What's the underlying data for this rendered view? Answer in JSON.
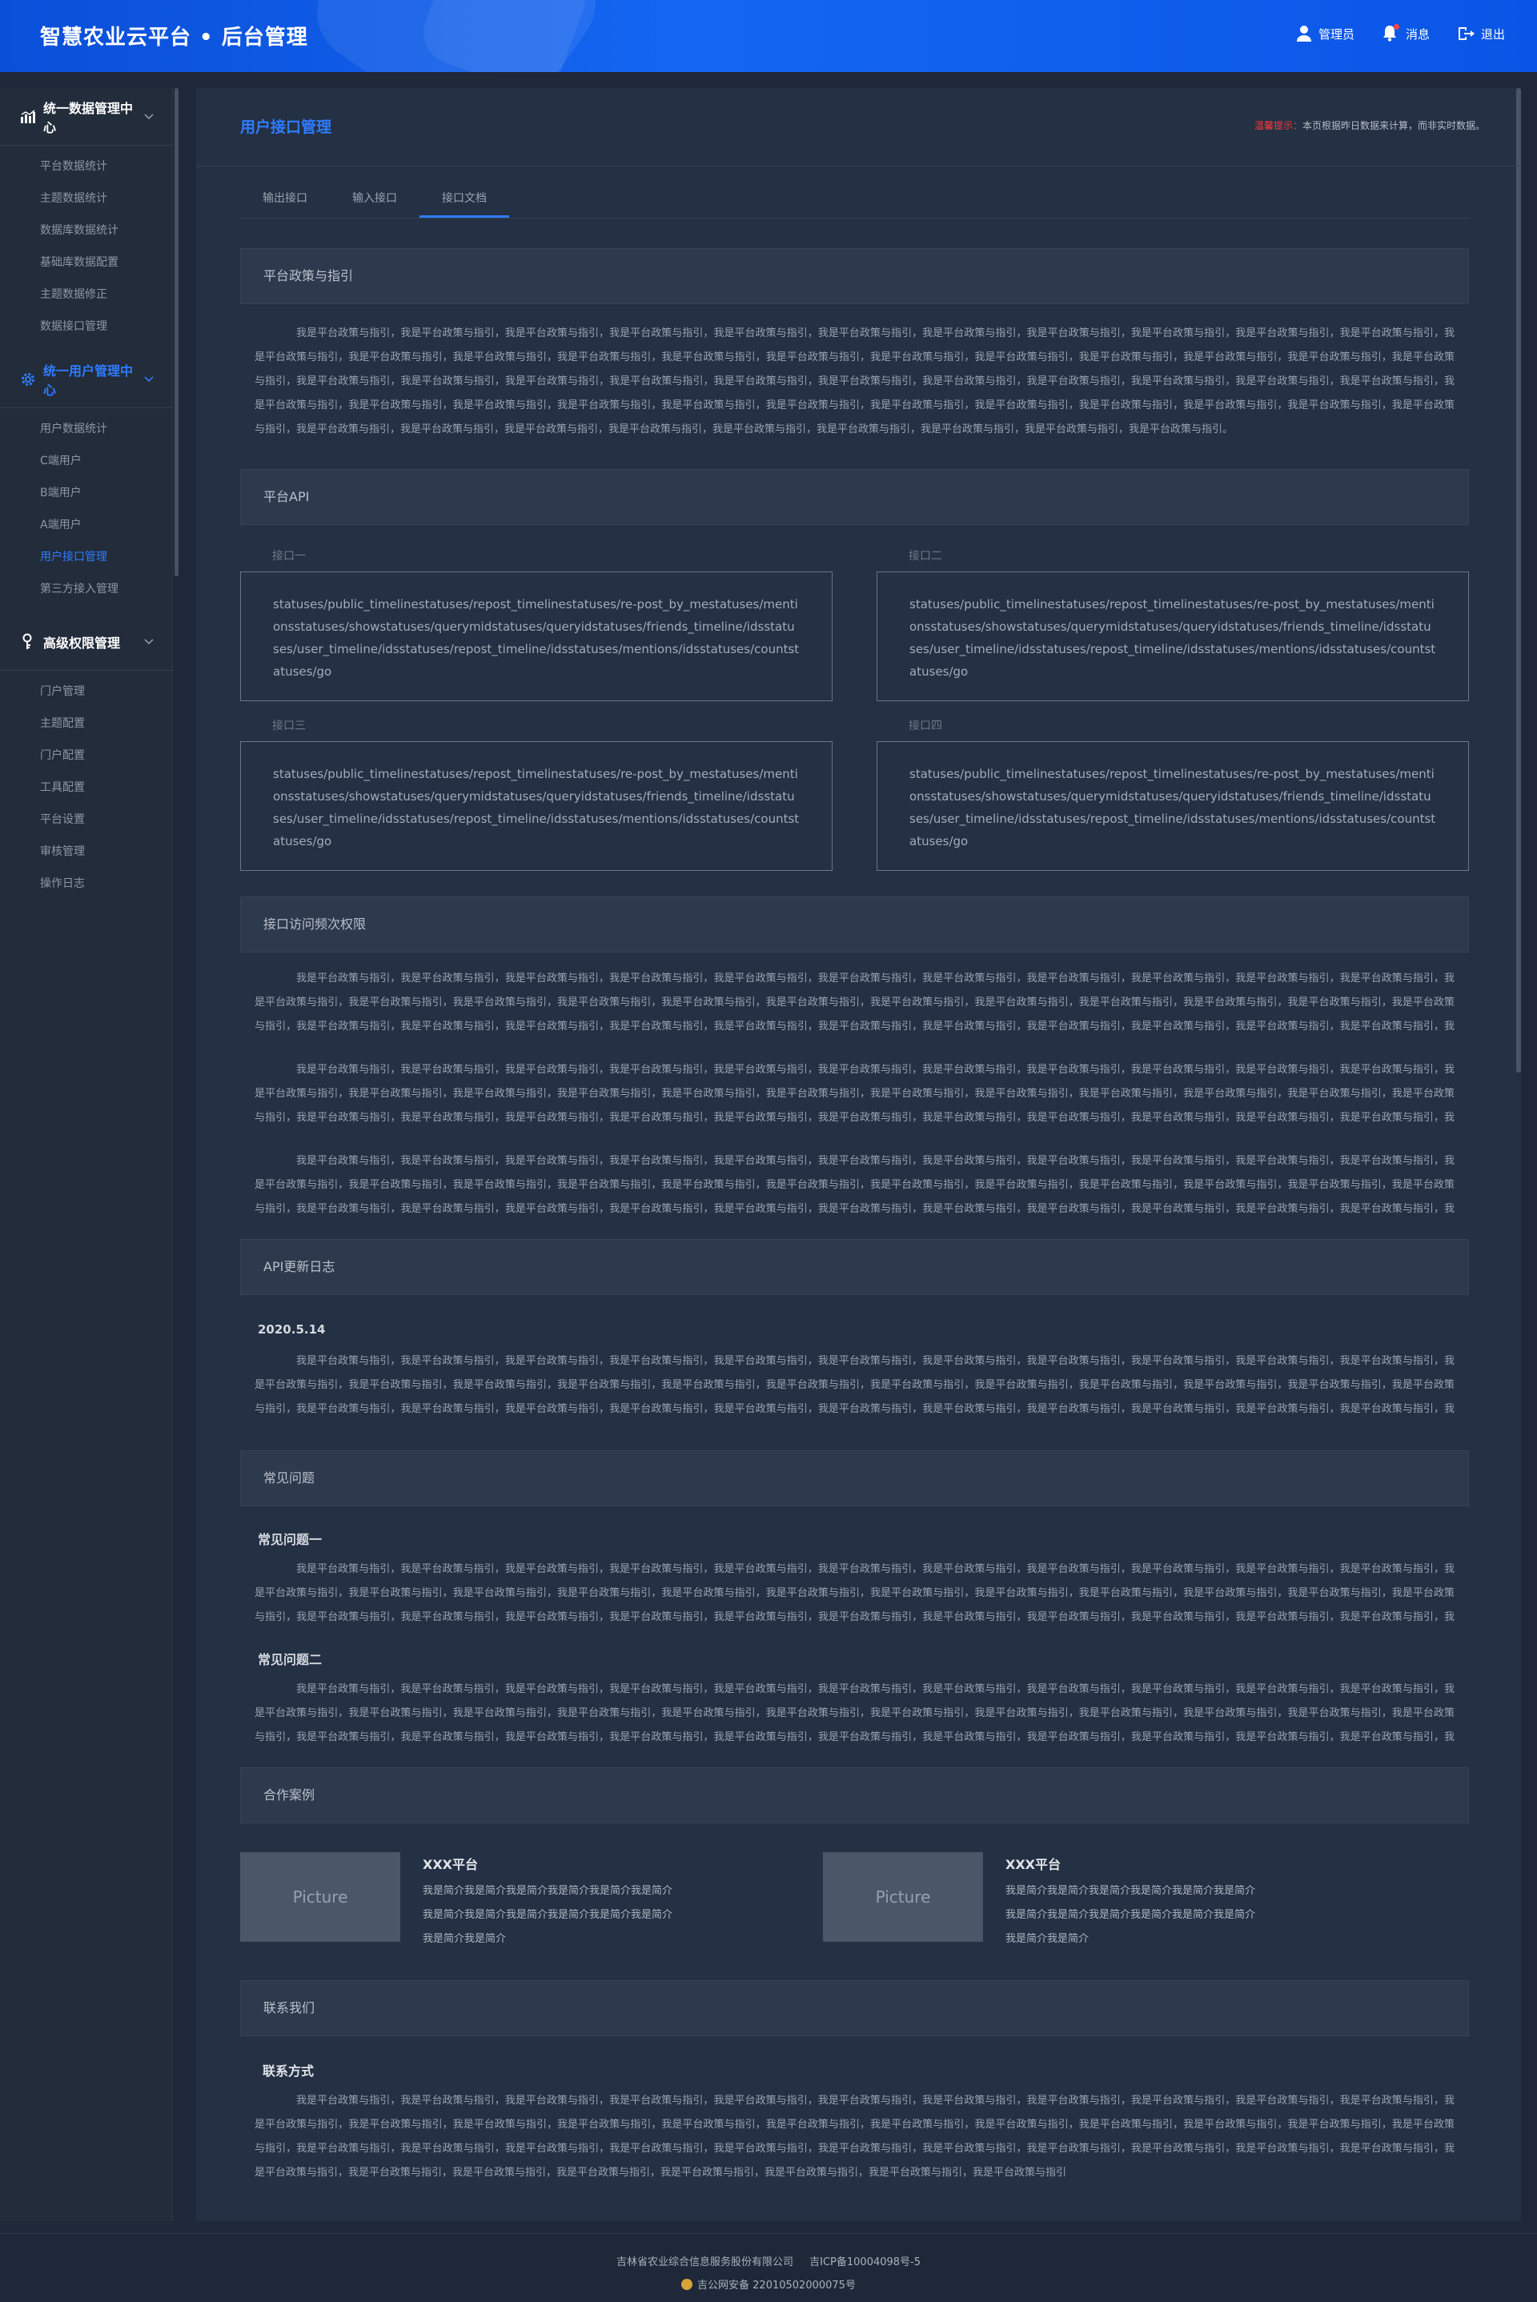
{
  "header": {
    "title": "智慧农业云平台 • 后台管理",
    "actions": [
      {
        "label": "管理员",
        "icon": "user-icon"
      },
      {
        "label": "消息",
        "icon": "bell-icon"
      },
      {
        "label": "退出",
        "icon": "logout-icon"
      }
    ]
  },
  "sidebar": {
    "groups": [
      {
        "label": "统一数据管理中心",
        "icon": "chart-icon",
        "items": [
          "平台数据统计",
          "主题数据统计",
          "数据库数据统计",
          "基础库数据配置",
          "主题数据修正",
          "数据接口管理"
        ]
      },
      {
        "label": "统一用户管理中心",
        "icon": "gear-icon",
        "items": [
          "用户数据统计",
          "C端用户",
          "B端用户",
          "A端用户",
          "用户接口管理",
          "第三方接入管理"
        ],
        "active_item_index": 4
      },
      {
        "label": "高级权限管理",
        "icon": "key-icon",
        "items": [
          "门户管理",
          "主题配置",
          "门户配置",
          "工具配置",
          "平台设置",
          "审核管理",
          "操作日志"
        ]
      }
    ]
  },
  "main": {
    "title": "用户接口管理",
    "notice_label": "温馨提示：",
    "notice_text": "本页根据昨日数据来计算，而非实时数据。",
    "tabs": [
      "输出接口",
      "输入接口",
      "接口文档"
    ],
    "active_tab": 2,
    "policy": {
      "heading": "平台政策与指引",
      "text": "我是平台政策与指引，我是平台政策与指引，我是平台政策与指引，我是平台政策与指引，我是平台政策与指引，我是平台政策与指引，我是平台政策与指引，我是平台政策与指引，我是平台政策与指引，我是平台政策与指引，我是平台政策与指引，我是平台政策与指引，我是平台政策与指引，我是平台政策与指引，我是平台政策与指引，我是平台政策与指引，我是平台政策与指引，我是平台政策与指引，我是平台政策与指引，我是平台政策与指引，我是平台政策与指引，我是平台政策与指引，我是平台政策与指引，我是平台政策与指引，我是平台政策与指引，我是平台政策与指引，我是平台政策与指引，我是平台政策与指引，我是平台政策与指引，我是平台政策与指引，我是平台政策与指引，我是平台政策与指引，我是平台政策与指引，我是平台政策与指引，我是平台政策与指引，我是平台政策与指引，我是平台政策与指引，我是平台政策与指引，我是平台政策与指引，我是平台政策与指引，我是平台政策与指引，我是平台政策与指引，我是平台政策与指引，我是平台政策与指引，我是平台政策与指引，我是平台政策与指引，我是平台政策与指引，我是平台政策与指引，我是平台政策与指引，我是平台政策与指引，我是平台政策与指引，我是平台政策与指引，我是平台政策与指引，我是平台政策与指引，我是平台政策与指引。"
    },
    "api": {
      "heading": "平台API",
      "items": [
        {
          "label": "接口一",
          "text": "statuses/public_timelinestatuses/repost_timelinestatuses/re-post_by_mestatuses/mentionsstatuses/showstatuses/querymidstatuses/queryidstatuses/friends_timeline/idsstatuses/user_timeline/idsstatuses/repost_timeline/idsstatuses/mentions/idsstatuses/countstatuses/go"
        },
        {
          "label": "接口二",
          "text": "statuses/public_timelinestatuses/repost_timelinestatuses/re-post_by_mestatuses/mentionsstatuses/showstatuses/querymidstatuses/queryidstatuses/friends_timeline/idsstatuses/user_timeline/idsstatuses/repost_timeline/idsstatuses/mentions/idsstatuses/countstatuses/go"
        },
        {
          "label": "接口三",
          "text": "statuses/public_timelinestatuses/repost_timelinestatuses/re-post_by_mestatuses/mentionsstatuses/showstatuses/querymidstatuses/queryidstatuses/friends_timeline/idsstatuses/user_timeline/idsstatuses/repost_timeline/idsstatuses/mentions/idsstatuses/countstatuses/go"
        },
        {
          "label": "接口四",
          "text": "statuses/public_timelinestatuses/repost_timelinestatuses/re-post_by_mestatuses/mentionsstatuses/showstatuses/querymidstatuses/queryidstatuses/friends_timeline/idsstatuses/user_timeline/idsstatuses/repost_timeline/idsstatuses/mentions/idsstatuses/countstatuses/go"
        }
      ]
    },
    "frequency": {
      "heading": "接口访问频次权限",
      "paragraphs": [
        "我是平台政策与指引，我是平台政策与指引，我是平台政策与指引，我是平台政策与指引，我是平台政策与指引，我是平台政策与指引，我是平台政策与指引，我是平台政策与指引，我是平台政策与指引，我是平台政策与指引，我是平台政策与指引，我是平台政策与指引，我是平台政策与指引，我是平台政策与指引，我是平台政策与指引，我是平台政策与指引，我是平台政策与指引，我是平台政策与指引，我是平台政策与指引，我是平台政策与指引，我是平台政策与指引，我是平台政策与指引，我是平台政策与指引，我是平台政策与指引，我是平台政策与指引，我是平台政策与指引，我是平台政策与指引，我是平台政策与指引，我是平台政策与指引，我是平台政策与指引，我是平台政策与指引，我是平台政策与指引，我是平台政策与指引，我是平台政策与指引，我是平台政策与指引，我是平台政策与指引，我是平台政策与指引，我是平台政策与指引，我是平台政策与指引，我是平台政策与指引，我是平台政策与指引，我是平台政策与指引，我是平台政策与指引，我是平台政策与指引",
        "我是平台政策与指引，我是平台政策与指引，我是平台政策与指引，我是平台政策与指引，我是平台政策与指引，我是平台政策与指引，我是平台政策与指引，我是平台政策与指引，我是平台政策与指引，我是平台政策与指引，我是平台政策与指引，我是平台政策与指引，我是平台政策与指引，我是平台政策与指引，我是平台政策与指引，我是平台政策与指引，我是平台政策与指引，我是平台政策与指引，我是平台政策与指引，我是平台政策与指引，我是平台政策与指引，我是平台政策与指引，我是平台政策与指引，我是平台政策与指引，我是平台政策与指引，我是平台政策与指引，我是平台政策与指引，我是平台政策与指引，我是平台政策与指引，我是平台政策与指引，我是平台政策与指引，我是平台政策与指引，我是平台政策与指引，我是平台政策与指引，我是平台政策与指引，我是平台政策与指引，我是平台政策与指引，我是平台政策与指引，我是平台政策与指引，我是平台政策与指引，我是平台政策与指引，我是平台政策与指引，我是平台政策与指引，我是平台政策与指引",
        "我是平台政策与指引，我是平台政策与指引，我是平台政策与指引，我是平台政策与指引，我是平台政策与指引，我是平台政策与指引，我是平台政策与指引，我是平台政策与指引，我是平台政策与指引，我是平台政策与指引，我是平台政策与指引，我是平台政策与指引，我是平台政策与指引，我是平台政策与指引，我是平台政策与指引，我是平台政策与指引，我是平台政策与指引，我是平台政策与指引，我是平台政策与指引，我是平台政策与指引，我是平台政策与指引，我是平台政策与指引，我是平台政策与指引，我是平台政策与指引，我是平台政策与指引，我是平台政策与指引，我是平台政策与指引，我是平台政策与指引，我是平台政策与指引，我是平台政策与指引，我是平台政策与指引，我是平台政策与指引，我是平台政策与指引，我是平台政策与指引，我是平台政策与指引，我是平台政策与指引，我是平台政策与指引，我是平台政策与指引，我是平台政策与指引，我是平台政策与指引，我是平台政策与指引，我是平台政策与指引，我是平台政策与指引，我是平台政策与指引"
      ]
    },
    "changelog": {
      "heading": "API更新日志",
      "date": "2020.5.14",
      "text": "我是平台政策与指引，我是平台政策与指引，我是平台政策与指引，我是平台政策与指引，我是平台政策与指引，我是平台政策与指引，我是平台政策与指引，我是平台政策与指引，我是平台政策与指引，我是平台政策与指引，我是平台政策与指引，我是平台政策与指引，我是平台政策与指引，我是平台政策与指引，我是平台政策与指引，我是平台政策与指引，我是平台政策与指引，我是平台政策与指引，我是平台政策与指引，我是平台政策与指引，我是平台政策与指引，我是平台政策与指引，我是平台政策与指引，我是平台政策与指引，我是平台政策与指引，我是平台政策与指引，我是平台政策与指引，我是平台政策与指引，我是平台政策与指引，我是平台政策与指引，我是平台政策与指引，我是平台政策与指引，我是平台政策与指引，我是平台政策与指引，我是平台政策与指引，我是平台政策与指引，我是平台政策与指引，我是平台政策与指引，我是平台政策与指引，我是平台政策与指引，我是平台政策与指引，我是平台政策与指引，我是平台政策与指引，我是平台政策与指引"
    },
    "faq": {
      "heading": "常见问题",
      "items": [
        {
          "title": "常见问题一",
          "text": "我是平台政策与指引，我是平台政策与指引，我是平台政策与指引，我是平台政策与指引，我是平台政策与指引，我是平台政策与指引，我是平台政策与指引，我是平台政策与指引，我是平台政策与指引，我是平台政策与指引，我是平台政策与指引，我是平台政策与指引，我是平台政策与指引，我是平台政策与指引，我是平台政策与指引，我是平台政策与指引，我是平台政策与指引，我是平台政策与指引，我是平台政策与指引，我是平台政策与指引，我是平台政策与指引，我是平台政策与指引，我是平台政策与指引，我是平台政策与指引，我是平台政策与指引，我是平台政策与指引，我是平台政策与指引，我是平台政策与指引，我是平台政策与指引，我是平台政策与指引，我是平台政策与指引，我是平台政策与指引，我是平台政策与指引，我是平台政策与指引，我是平台政策与指引，我是平台政策与指引，我是平台政策与指引，我是平台政策与指引，我是平台政策与指引，我是平台政策与指引，我是平台政策与指引，我是平台政策与指引，我是平台政策与指引，我是平台政策与指引"
        },
        {
          "title": "常见问题二",
          "text": "我是平台政策与指引，我是平台政策与指引，我是平台政策与指引，我是平台政策与指引，我是平台政策与指引，我是平台政策与指引，我是平台政策与指引，我是平台政策与指引，我是平台政策与指引，我是平台政策与指引，我是平台政策与指引，我是平台政策与指引，我是平台政策与指引，我是平台政策与指引，我是平台政策与指引，我是平台政策与指引，我是平台政策与指引，我是平台政策与指引，我是平台政策与指引，我是平台政策与指引，我是平台政策与指引，我是平台政策与指引，我是平台政策与指引，我是平台政策与指引，我是平台政策与指引，我是平台政策与指引，我是平台政策与指引，我是平台政策与指引，我是平台政策与指引，我是平台政策与指引，我是平台政策与指引，我是平台政策与指引，我是平台政策与指引，我是平台政策与指引，我是平台政策与指引，我是平台政策与指引，我是平台政策与指引，我是平台政策与指引，我是平台政策与指引，我是平台政策与指引，我是平台政策与指引，我是平台政策与指引，我是平台政策与指引，我是平台政策与指引"
        }
      ]
    },
    "cases": {
      "heading": "合作案例",
      "items": [
        {
          "picture": "Picture",
          "title": "XXX平台",
          "desc": "我是简介我是简介我是简介我是简介我是简介我是简介我是简介我是简介我是简介我是简介我是简介我是简介我是简介我是简介"
        },
        {
          "picture": "Picture",
          "title": "XXX平台",
          "desc": "我是简介我是简介我是简介我是简介我是简介我是简介我是简介我是简介我是简介我是简介我是简介我是简介我是简介我是简介"
        }
      ]
    },
    "contact": {
      "heading": "联系我们",
      "title": "联系方式",
      "text": "我是平台政策与指引，我是平台政策与指引，我是平台政策与指引，我是平台政策与指引，我是平台政策与指引，我是平台政策与指引，我是平台政策与指引，我是平台政策与指引，我是平台政策与指引，我是平台政策与指引，我是平台政策与指引，我是平台政策与指引，我是平台政策与指引，我是平台政策与指引，我是平台政策与指引，我是平台政策与指引，我是平台政策与指引，我是平台政策与指引，我是平台政策与指引，我是平台政策与指引，我是平台政策与指引，我是平台政策与指引，我是平台政策与指引，我是平台政策与指引，我是平台政策与指引，我是平台政策与指引，我是平台政策与指引，我是平台政策与指引，我是平台政策与指引，我是平台政策与指引，我是平台政策与指引，我是平台政策与指引，我是平台政策与指引，我是平台政策与指引，我是平台政策与指引，我是平台政策与指引，我是平台政策与指引，我是平台政策与指引，我是平台政策与指引，我是平台政策与指引，我是平台政策与指引，我是平台政策与指引"
    }
  },
  "footer": {
    "company": "吉林省农业综合信息服务股份有限公司",
    "icp": "吉ICP备10004098号-5",
    "police": "吉公网安备 22010502000075号"
  },
  "colors": {
    "accent": "#2f7cff",
    "header": "#1466f2",
    "background": "#1e2838",
    "panel": "#243043",
    "warning": "#ff3b3b"
  }
}
